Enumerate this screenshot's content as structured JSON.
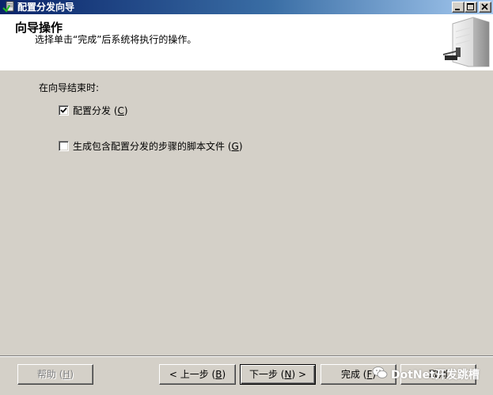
{
  "window": {
    "title": "配置分发向导"
  },
  "header": {
    "title": "向导操作",
    "description": "选择单击“完成”后系统将执行的操作。"
  },
  "body": {
    "end_label": "在向导结束时:",
    "options": [
      {
        "label": "配置分发",
        "mnemonic": "C",
        "checked": true
      },
      {
        "label": "生成包含配置分发的步骤的脚本文件",
        "mnemonic": "G",
        "checked": false
      }
    ]
  },
  "footer": {
    "help": {
      "label": "帮助",
      "mnemonic": "H",
      "enabled": false
    },
    "back": {
      "prefix": "<",
      "label": "上一步",
      "mnemonic": "B"
    },
    "next": {
      "label": "下一步",
      "mnemonic": "N",
      "suffix": ">"
    },
    "finish": {
      "label": "完成",
      "mnemonic": "F"
    },
    "cancel": {
      "label": "取消"
    }
  },
  "watermark": {
    "text": "DotNet开发跳槽"
  },
  "colors": {
    "face": "#d4d0c8",
    "titlebar_start": "#0a246a",
    "titlebar_end": "#a6caf0"
  }
}
